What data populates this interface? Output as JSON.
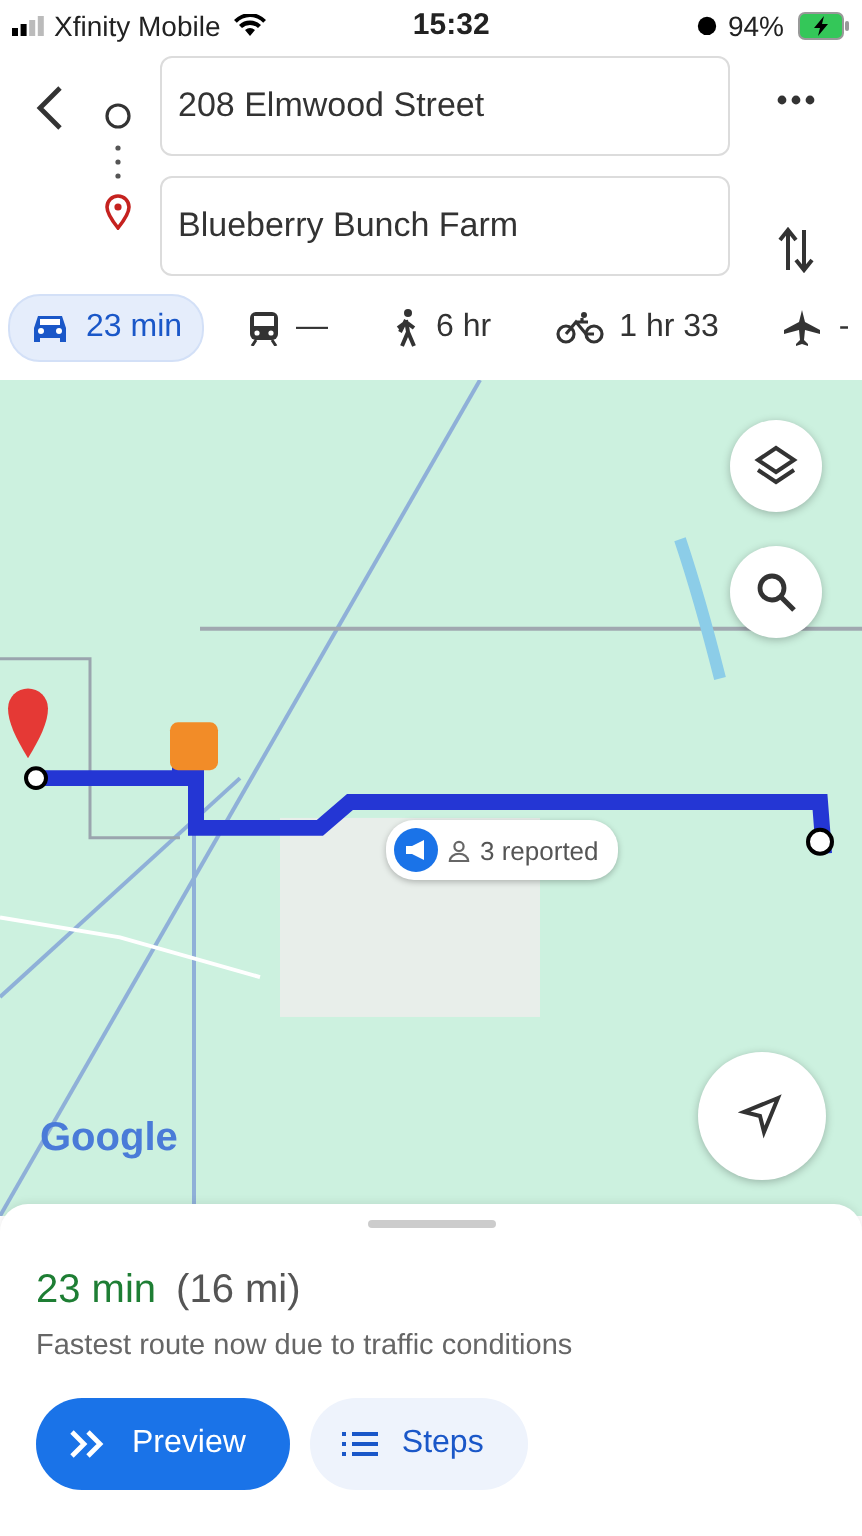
{
  "status_bar": {
    "carrier": "Xfinity Mobile",
    "time": "15:32",
    "battery": "94%"
  },
  "route": {
    "origin": "208 Elmwood Street",
    "destination": "Blueberry Bunch Farm"
  },
  "modes": [
    {
      "label": "23 min",
      "selected": true
    },
    {
      "label": "—",
      "selected": false
    },
    {
      "label": "6 hr",
      "selected": false
    },
    {
      "label": "1 hr 33",
      "selected": false
    },
    {
      "label": "-",
      "selected": false
    }
  ],
  "map": {
    "kind": "picture",
    "traffic_callout": "3 reported",
    "logo": "Google"
  },
  "sheet": {
    "duration": "23 min",
    "distance": "(16 mi)",
    "note": "Fastest route now due to traffic conditions",
    "buttons": [
      "Preview",
      "Steps"
    ]
  }
}
